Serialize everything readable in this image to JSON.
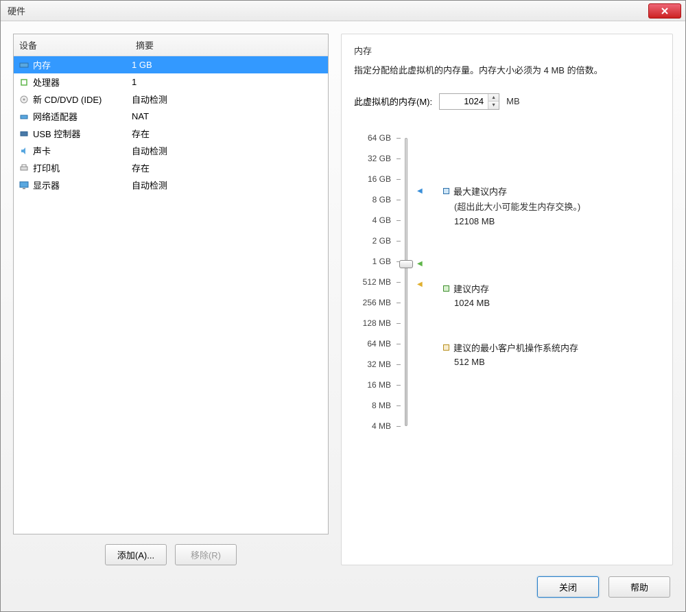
{
  "window": {
    "title": "硬件"
  },
  "columns": {
    "device": "设备",
    "summary": "摘要"
  },
  "devices": [
    {
      "icon": "memory",
      "name": "内存",
      "summary": "1 GB",
      "selected": true
    },
    {
      "icon": "cpu",
      "name": "处理器",
      "summary": "1"
    },
    {
      "icon": "disc",
      "name": "新 CD/DVD (IDE)",
      "summary": "自动检测"
    },
    {
      "icon": "network",
      "name": "网络适配器",
      "summary": "NAT"
    },
    {
      "icon": "usb",
      "name": "USB 控制器",
      "summary": "存在"
    },
    {
      "icon": "sound",
      "name": "声卡",
      "summary": "自动检测"
    },
    {
      "icon": "printer",
      "name": "打印机",
      "summary": "存在"
    },
    {
      "icon": "display",
      "name": "显示器",
      "summary": "自动检测"
    }
  ],
  "buttons": {
    "add": "添加(A)...",
    "remove": "移除(R)",
    "close": "关闭",
    "help": "帮助"
  },
  "memory": {
    "title": "内存",
    "description": "指定分配给此虚拟机的内存量。内存大小必须为 4 MB 的倍数。",
    "input_label": "此虚拟机的内存(M):",
    "input_value": "1024",
    "unit": "MB",
    "ticks": [
      "64 GB",
      "32 GB",
      "16 GB",
      "8 GB",
      "4 GB",
      "2 GB",
      "1 GB",
      "512 MB",
      "256 MB",
      "128 MB",
      "64 MB",
      "32 MB",
      "16 MB",
      "8 MB",
      "4 MB"
    ],
    "legend": {
      "max": {
        "label": "最大建议内存",
        "note": "(超出此大小可能发生内存交换。)",
        "value": "12108 MB",
        "color": "#3a8fd9"
      },
      "rec": {
        "label": "建议内存",
        "value": "1024 MB",
        "color": "#5fb54a"
      },
      "min": {
        "label": "建议的最小客户机操作系统内存",
        "value": "512 MB",
        "color": "#e0b030"
      }
    }
  }
}
